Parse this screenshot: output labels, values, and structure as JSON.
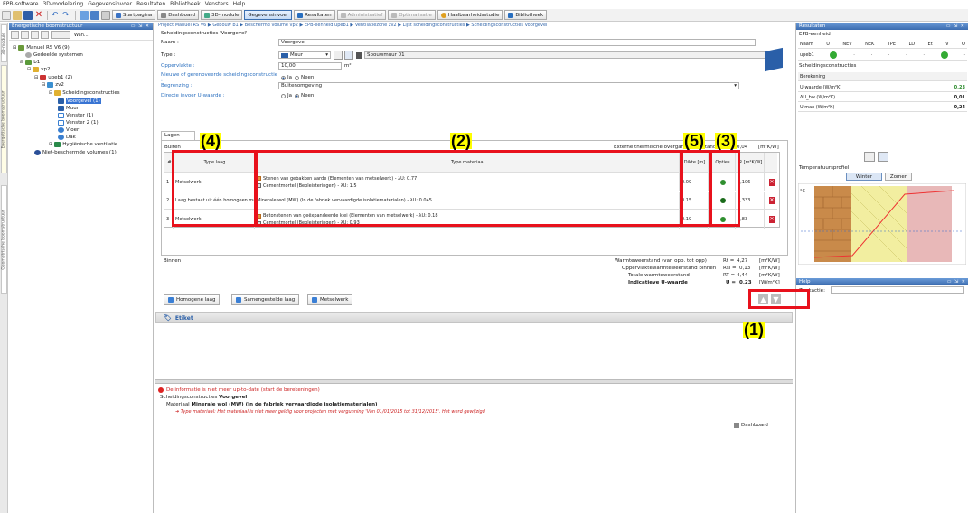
{
  "menu": {
    "items": [
      "EPB-software",
      "3D-modelering",
      "Gegevensinvoer",
      "Resultaten",
      "Bibliotheek",
      "Vensters",
      "Help"
    ]
  },
  "toolbar": {
    "start": "Startpagina",
    "dashboard": "Dashboard",
    "module3d": "3D-module",
    "gegevens": "Gegevensinvoer",
    "resultaten": "Resultaten",
    "admin": "Administratief",
    "optimalisatie": "Optimalisatie",
    "haalbaar": "Haalbaarheidsstudie",
    "biblio": "Bibliotheek"
  },
  "sidebar_tabs": {
    "tab1": "3D-module",
    "tab2": "Energetische boomstructuur",
    "tab3": "Geometrische boomstructuur"
  },
  "tree": {
    "title": "Energetische boomstructuur",
    "search": "Wan...",
    "nodes": [
      "Manuel RS V6 (9)",
      "Gedeelde systemen",
      "b1",
      "vp2",
      "upeb1 (2)",
      "zv2",
      "Scheidingsconstructies",
      "Voorgevel (1)",
      "Muur",
      "Venster (1)",
      "Venster 2 (1)",
      "Vloer",
      "Dak",
      "Hygiënische ventilatie",
      "Niet-beschermde volumes (1)"
    ]
  },
  "breadcrumb": "Project Manuel RS V6 ▶ Gebouw b1 ▶ Beschermd volume vp2 ▶ EPB-eenheid upeb1 ▶ Ventilatiezone zv2 ▶ Lijst scheidingsconstructies ▶ Scheidingsconstructies Voorgevel",
  "main": {
    "title": "Scheidingsconstructies 'Voorgevel'",
    "naam_label": "Naam :",
    "naam_value": "Voorgevel",
    "type_label": "Type :",
    "type_value": "Muur",
    "type_extra": "Spouwmuur 01",
    "opp_label": "Oppervlakte :",
    "opp_value": "10,00",
    "opp_unit": "m²",
    "nieuw_label": "Nieuwe of gerenoveerde scheidingsconstructie :",
    "ja": "Ja",
    "neen": "Neen",
    "begrenzing_label": "Begrenzing :",
    "begrenzing_value": "Buitenomgeving",
    "directe_label": "Directe invoer U-waarde :",
    "tab": "Lagen",
    "buiten": "Buiten",
    "ext_label": "Externe thermische overgangsweerstand",
    "ext_value": "0,04",
    "ext_unit": "[m²K/W]",
    "binnen": "Binnen"
  },
  "table": {
    "h_nr": "#",
    "h_type": "Type laag",
    "h_mat": "Type materiaal",
    "h_dikte": "Dikte [m]",
    "h_opties": "Opties",
    "h_r": "R [m²K/W]",
    "rows": [
      {
        "nr": "1",
        "type": "Metselwerk",
        "mat1": "Stenen van gebakken aarde (Elementen van metselwerk) - λU: 0.77",
        "mat2": "Cementmortel (Bepleisteringen) - λU: 1.5",
        "dikte": "0.09",
        "r": "0,106"
      },
      {
        "nr": "2",
        "type": "Laag bestaat uit één homogeen materiaal",
        "mat1": "Minerale wol (MW) (In de fabriek vervaardigde isolatiematerialen) - λU: 0.045",
        "mat2": "",
        "dikte": "0.15",
        "r": "3,333"
      },
      {
        "nr": "3",
        "type": "Metselwerk",
        "mat1": "Betonstenen van geëxpandeerde klei (Elementen van metselwerk) - λU: 0.18",
        "mat2": "Cementmortel (Bepleisteringen) - λU: 0.93",
        "dikte": "0.19",
        "r": "0,83"
      }
    ]
  },
  "results": {
    "rt_label": "Warmteweerstand (van opp. tot opp)",
    "rt_sym": "Rt =",
    "rt_value": "4,27",
    "rsi_label": "Oppervlaktewarmteweerstand binnen",
    "rsi_sym": "Rsi =",
    "rsi_value": "0,13",
    "rtot_label": "Totale warmteweerstand",
    "rtot_sym": "RT =",
    "rtot_value": "4,44",
    "u_label": "Indicatieve U-waarde",
    "u_sym": "U =",
    "u_value": "0,23",
    "unit_r": "[m²K/W]",
    "unit_u": "[W/m²K]"
  },
  "buttons": {
    "homogeen": "Homogene laag",
    "samengesteld": "Samengestelde laag",
    "metselwerk": "Metselwerk"
  },
  "etiket": "Etiket",
  "bottom": {
    "warn": "De informatie is niet meer up-to-date (start de berekeningen)",
    "line1": "Scheidingsconstructies",
    "line1b": "Voorgevel",
    "line2": "Materiaal",
    "line2b": "Minerale wol (MW) (In de fabriek vervaardigde isolatiematerialen)",
    "line3": "Type materiaal: Het materiaal is niet meer geldig voor projecten met vergunning 'Van 01/01/2015 tot 31/12/2015'. Het werd gewijzigd",
    "dashboard": "Dashboard"
  },
  "right": {
    "title": "Resultaten",
    "sub": "EPB-eenheid",
    "cols": [
      "Naam",
      "U",
      "NEV",
      "NEK",
      "TPE",
      "LD",
      "Et",
      "V",
      "O"
    ],
    "row": "upeb1",
    "sc": "Scheidingsconstructies",
    "ber": "Berekening",
    "u_label": "U-waarde (W/m²K)",
    "u_val": "0,23",
    "dub_label": "ΔU_bw (W/m²K)",
    "dub_val": "0,01",
    "umax_label": "U max (W/m²K)",
    "umax_val": "0,24",
    "temp": "Temperatuursprofiel",
    "winter": "Winter",
    "zomer": "Zomer",
    "help": "Help",
    "zoek": "Zoekactie:"
  },
  "annotations": {
    "a1": "(1)",
    "a2": "(2)",
    "a3": "(3)",
    "a4": "(4)",
    "a5": "(5)"
  },
  "colors": {
    "red": "#e8111c",
    "yellow": "#ffff00",
    "blue": "#3c6cb0"
  }
}
